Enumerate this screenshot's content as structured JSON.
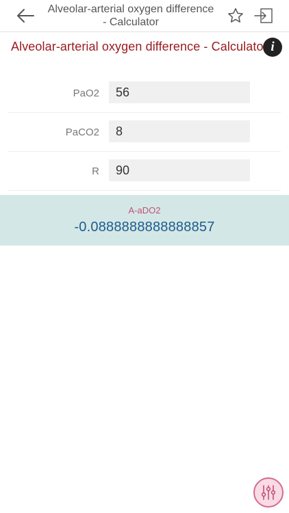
{
  "navbar": {
    "title": "Alveolar-arterial oxygen difference - Calculator",
    "back_icon": "arrow-left-icon",
    "favorite_icon": "star-outline-icon",
    "exit_icon": "exit-to-app-icon"
  },
  "header": {
    "title": "Alveolar-arterial oxygen difference - Calculator",
    "info_glyph": "i",
    "info_icon": "info-icon"
  },
  "form": {
    "fields": [
      {
        "label": "PaO2",
        "value": "56"
      },
      {
        "label": "PaCO2",
        "value": "8"
      },
      {
        "label": "R",
        "value": "90"
      }
    ]
  },
  "result": {
    "label": "A-aDO2",
    "value": "-0.0888888888888857"
  },
  "fab": {
    "icon": "sliders-icon"
  },
  "colors": {
    "title_red": "#9b1c20",
    "result_background": "#d3e8e6",
    "result_label": "#c14f7a",
    "result_value": "#1f5a8f",
    "fab_border": "#d56a8e",
    "fab_fill": "#f9dbe5"
  }
}
